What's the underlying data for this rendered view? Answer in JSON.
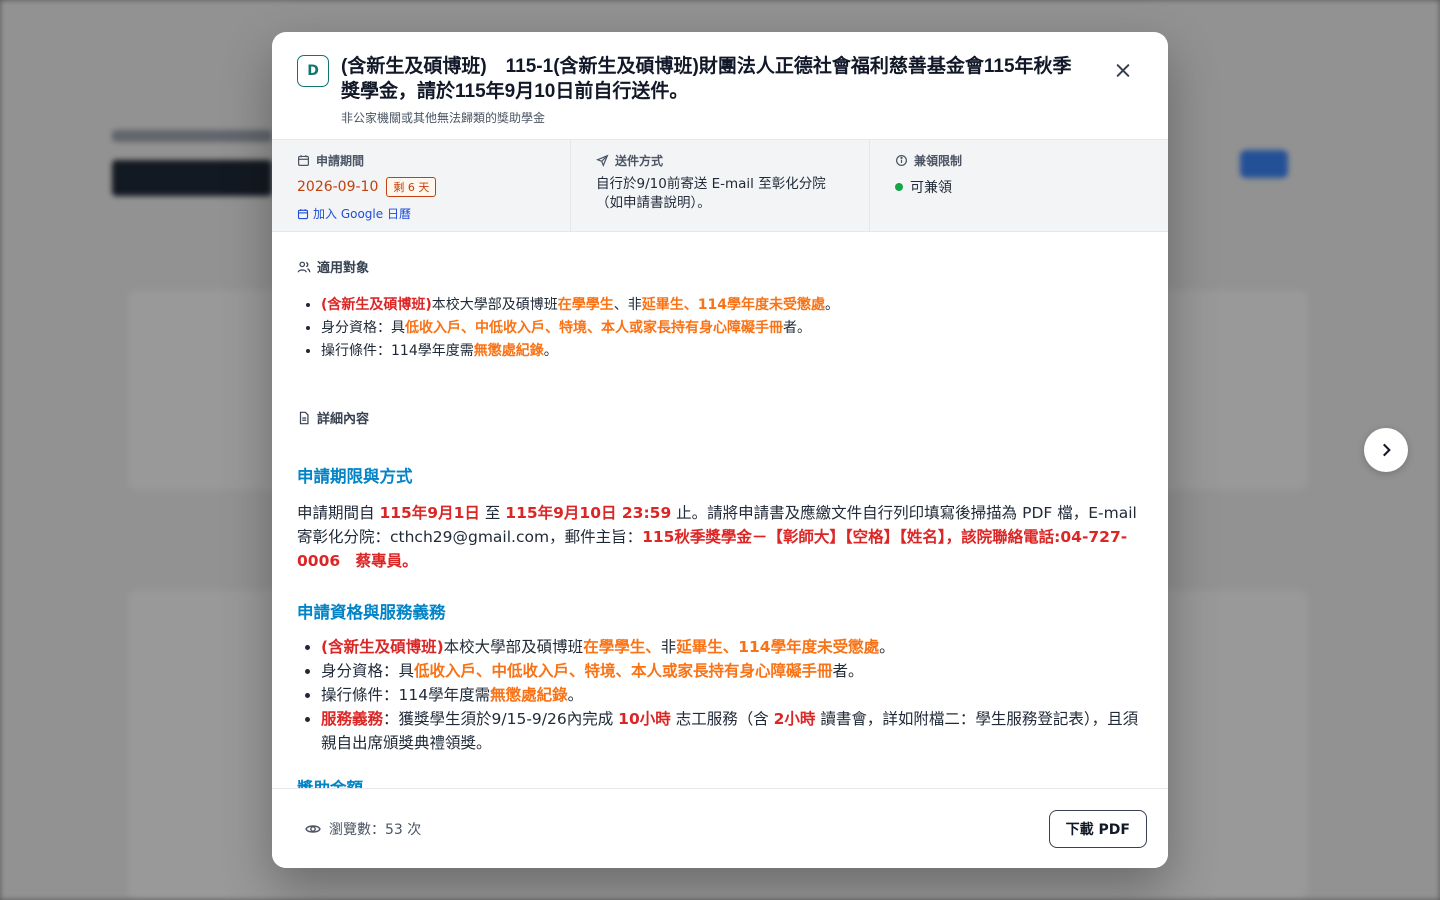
{
  "modal": {
    "logo_letter": "D",
    "title": "(含新生及碩博班)　115-1(含新生及碩博班)財團法人正德社會福利慈善基金會115年秋季獎學金，請於115年9月10日前自行送件。",
    "subtitle": "非公家機關或其他無法歸類的獎助學金"
  },
  "info": {
    "period_label": "申請期間",
    "date": "2026-09-10",
    "days_left": "剩 6 天",
    "gcal": "加入 Google 日曆",
    "send_label": "送件方式",
    "send_text": "自行於9/10前寄送 E-mail 至彰化分院（如申請書說明）。",
    "dual_label": "兼領限制",
    "dual_value": "可兼領"
  },
  "eligibility": {
    "label": "適用對象",
    "items": [
      [
        "(含新生及碩博班)",
        "本校大學部及碩博班",
        "在學學生",
        "、非",
        "延畢生、114學年度未受懲處",
        "。"
      ],
      [
        "身分資格：具",
        "低收入戶、中低收入戶、特境、本人或家長持有身心障礙手冊",
        "者。"
      ],
      [
        "操行條件：114學年度需",
        "無懲處紀錄",
        "。"
      ]
    ]
  },
  "details": {
    "label": "詳細內容",
    "h_method": "申請期限與方式",
    "p1": "申請期間自",
    "p1_start": "115年9月1日",
    "p1_to": "至",
    "p1_end": "115年9月10日 23:59",
    "p1_rest": "止。請將申請書及應繳文件自行列印填寫後掃描為 PDF 檔，E-mail 寄彰化分院：cthch29@gmail.com，郵件主旨：",
    "p1_subject": "115秋季獎學金－【彰師大】【空格】【姓名】，該院聯絡電話:04-727-0006　蔡專員。",
    "h_qual": "申請資格與服務義務",
    "items": [
      [
        "(含新生及碩博班)",
        "本校大學部及碩博班",
        "在學學生、",
        "非",
        "延畢生、114學年度未受懲處",
        "。"
      ],
      [
        "身分資格：具",
        "低收入戶、中低收入戶、特境、本人或家長持有身心障礙手冊",
        "者。"
      ],
      [
        "操行條件：114學年度需",
        "無懲處紀錄",
        "。"
      ],
      [
        "服務義務",
        "：獲獎學生須於9/15-9/26內完成",
        "10小時",
        "志工服務（含",
        "2小時",
        "讀書會，詳如附檔二：學生服務登記表），且須親自出席頒獎典禮領獎。"
      ]
    ],
    "h_amount": "獎助金額"
  },
  "footer": {
    "views": "瀏覽數：53 次",
    "download": "下載 PDF"
  }
}
